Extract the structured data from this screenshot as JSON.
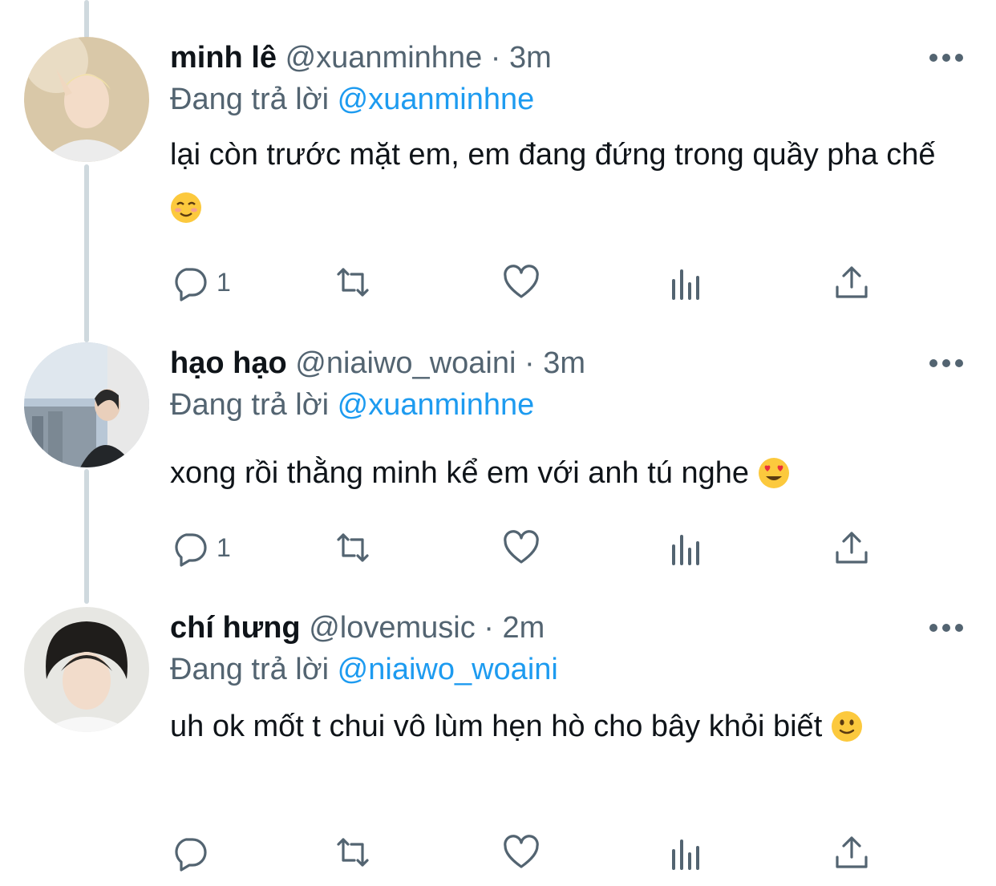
{
  "replying_prefix": "Đang trả lời",
  "tweets": [
    {
      "name": "minh lê",
      "handle": "@xuanminhne",
      "separator": "·",
      "time": "3m",
      "replying_to": "@xuanminhne",
      "text": "lại còn trước mặt em, em đang đứng trong quầy pha chế",
      "emoji": "smiling-blush-emoji",
      "reply_count": "1"
    },
    {
      "name": "hạo hạo",
      "handle": "@niaiwo_woaini",
      "separator": "·",
      "time": "3m",
      "replying_to": "@xuanminhne",
      "text": "xong rồi thằng minh kể em với anh tú nghe",
      "emoji": "heart-eyes-emoji",
      "reply_count": "1"
    },
    {
      "name": "chí hưng",
      "handle": "@lovemusic",
      "separator": "·",
      "time": "2m",
      "replying_to": "@niaiwo_woaini",
      "text": "uh ok mốt t chui vô lùm hẹn hò cho bây khỏi biết",
      "emoji": "slight-smile-emoji",
      "reply_count": ""
    }
  ],
  "icons": {
    "reply": "reply-icon",
    "retweet": "retweet-icon",
    "like": "heart-icon",
    "analytics": "analytics-icon",
    "share": "share-icon",
    "more": "more-icon"
  },
  "colors": {
    "text": "#0f1419",
    "secondary": "#536471",
    "accent": "#1d9bf0",
    "thread_line": "#cfd9de"
  }
}
